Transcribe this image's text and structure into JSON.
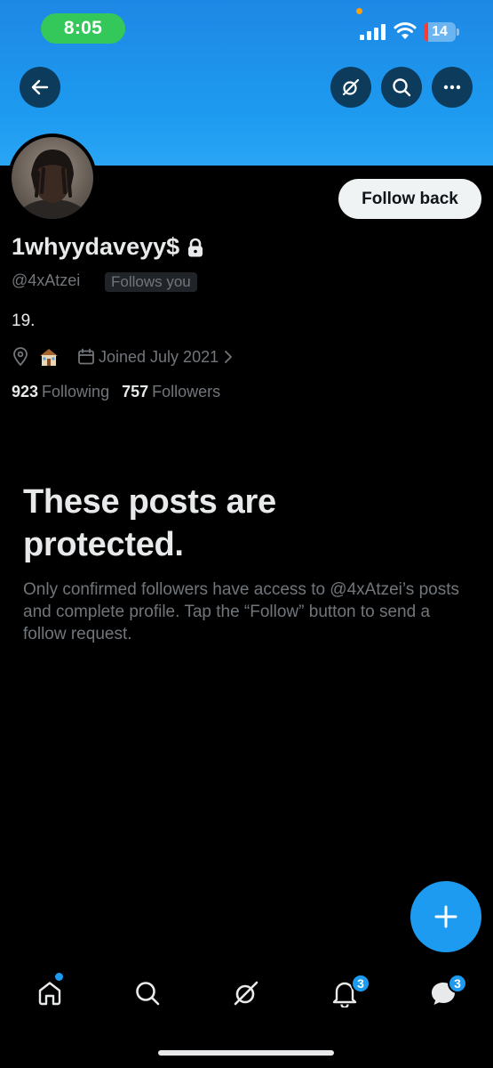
{
  "status_bar": {
    "time": "8:05",
    "battery_level": "14",
    "battery_fraction": 0.14
  },
  "profile": {
    "display_name": "1whyydaveyy$",
    "handle": "@4xAtzei",
    "follows_you_badge": "Follows you",
    "follow_button_label": "Follow back",
    "bio": "19.",
    "location_emoji": "🏠",
    "joined": "Joined July 2021",
    "following_count": "923",
    "following_label": "Following",
    "followers_count": "757",
    "followers_label": "Followers"
  },
  "protected_notice": {
    "title": "These posts are protected.",
    "body": "Only confirmed followers have access to @4xAtzei’s posts and complete profile. Tap the “Follow” button to send a follow request."
  },
  "tab_bar": {
    "notifications_badge": "3",
    "messages_badge": "3"
  },
  "colors": {
    "accent": "#1d9bf0",
    "background": "#000000",
    "time_pill": "#34c759",
    "battery_low": "#ff3b30"
  },
  "icons": [
    "back-arrow-icon",
    "grok-icon",
    "search-icon",
    "more-icon",
    "lock-icon",
    "location-pin-icon",
    "calendar-icon",
    "chevron-right-icon",
    "compose-plus-icon",
    "home-icon",
    "notifications-icon",
    "messages-icon"
  ]
}
